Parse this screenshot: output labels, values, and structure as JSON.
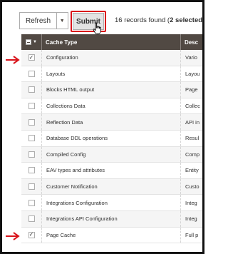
{
  "toolbar": {
    "mass_action": "Refresh",
    "submit_label": "Submit",
    "records_prefix": "16 records found (",
    "records_selected": "2 selected",
    "records_suffix": ")"
  },
  "grid": {
    "columns": {
      "type": "Cache Type",
      "description": "Desc"
    },
    "rows": [
      {
        "type": "Configuration",
        "description": "Vario",
        "checked": true
      },
      {
        "type": "Layouts",
        "description": "Layou",
        "checked": false
      },
      {
        "type": "Blocks HTML output",
        "description": "Page",
        "checked": false
      },
      {
        "type": "Collections Data",
        "description": "Collec",
        "checked": false
      },
      {
        "type": "Reflection Data",
        "description": "API in",
        "checked": false
      },
      {
        "type": "Database DDL operations",
        "description": "Resul",
        "checked": false
      },
      {
        "type": "Compiled Config",
        "description": "Comp",
        "checked": false
      },
      {
        "type": "EAV types and attributes",
        "description": "Entity",
        "checked": false
      },
      {
        "type": "Customer Notification",
        "description": "Custo",
        "checked": false
      },
      {
        "type": "Integrations Configuration",
        "description": "Integ",
        "checked": false
      },
      {
        "type": "Integrations API Configuration",
        "description": "Integ",
        "checked": false
      },
      {
        "type": "Page Cache",
        "description": "Full p",
        "checked": true
      }
    ]
  },
  "annotation_color": "#d9141b"
}
